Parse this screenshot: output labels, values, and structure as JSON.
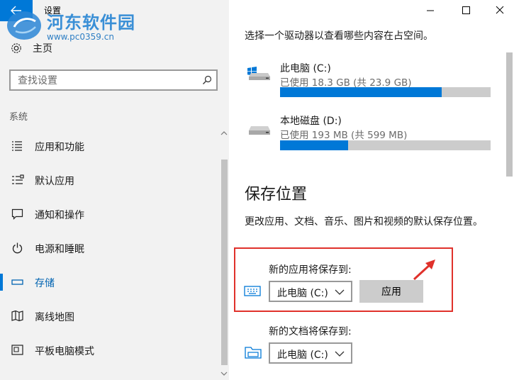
{
  "window": {
    "title": "设置",
    "back_icon": "back-arrow-icon",
    "controls": [
      "minimize-icon",
      "maximize-icon",
      "close-icon"
    ]
  },
  "watermark": {
    "title": "河东软件园",
    "url": "www.pc0359.cn"
  },
  "sidebar": {
    "home_label": "主页",
    "search_placeholder": "查找设置",
    "section_label": "系统",
    "items": [
      {
        "label": "应用和功能",
        "icon": "apps-list-icon",
        "active": false
      },
      {
        "label": "默认应用",
        "icon": "default-apps-icon",
        "active": false
      },
      {
        "label": "通知和操作",
        "icon": "notification-icon",
        "active": false
      },
      {
        "label": "电源和睡眠",
        "icon": "power-icon",
        "active": false
      },
      {
        "label": "存储",
        "icon": "storage-icon",
        "active": true
      },
      {
        "label": "离线地图",
        "icon": "map-icon",
        "active": false
      },
      {
        "label": "平板电脑模式",
        "icon": "tablet-mode-icon",
        "active": false
      }
    ]
  },
  "main": {
    "intro": "选择一个驱动器以查看哪些内容在占空间。",
    "drives": [
      {
        "name": "此电脑 (C:)",
        "usage": "已使用 18.3 GB (共 23.9 GB)",
        "used_fraction": 0.766,
        "icon": "windows-drive-icon"
      },
      {
        "name": "本地磁盘 (D:)",
        "usage": "已使用 193 MB (共 599 MB)",
        "used_fraction": 0.322,
        "icon": "local-disk-icon"
      }
    ],
    "save_heading": "保存位置",
    "save_desc": "更改应用、文档、音乐、图片和视频的默认保存位置。",
    "new_apps": {
      "label": "新的应用将保存到:",
      "value": "此电脑 (C:)",
      "apply_label": "应用",
      "icon": "apps-location-icon"
    },
    "new_docs": {
      "label": "新的文档将保存到:",
      "value": "此电脑 (C:)",
      "icon": "folder-location-icon"
    }
  },
  "colors": {
    "accent": "#0078d7",
    "highlight": "#e0312b",
    "sidebar_bg": "#f2f2f2"
  }
}
